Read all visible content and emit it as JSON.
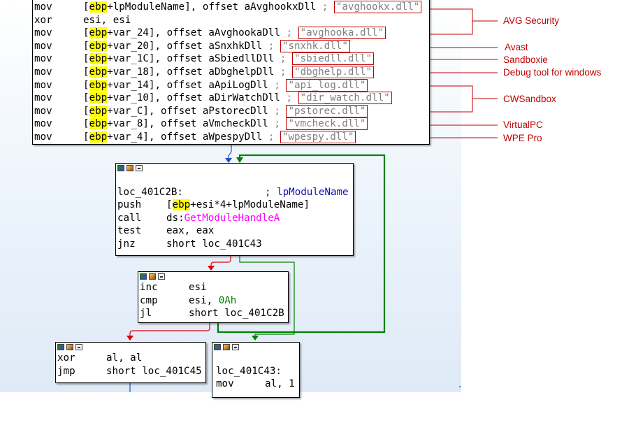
{
  "top_block": {
    "rows": [
      {
        "mn": "mov",
        "hl": "ebp",
        "rest": "+lpModuleName], offset aAvghookxDll",
        "comment": ";",
        "str": "\"avghookx.dll\""
      },
      {
        "mn": "xor",
        "op": "esi, esi"
      },
      {
        "mn": "mov",
        "hl": "ebp",
        "rest": "+var_24], offset aAvghookaDll",
        "comment": ";",
        "str": "\"avghooka.dll\""
      },
      {
        "mn": "mov",
        "hl": "ebp",
        "rest": "+var_20], offset aSnxhkDll",
        "comment": ";",
        "str": "\"snxhk.dll\""
      },
      {
        "mn": "mov",
        "hl": "ebp",
        "rest": "+var_1C], offset aSbiedllDll",
        "comment": ";",
        "str": "\"sbiedll.dll\""
      },
      {
        "mn": "mov",
        "hl": "ebp",
        "rest": "+var_18], offset aDbghelpDll",
        "comment": ";",
        "str": "\"dbghelp.dll\""
      },
      {
        "mn": "mov",
        "hl": "ebp",
        "rest": "+var_14], offset aApiLogDll",
        "comment": ";",
        "str": "\"api_log.dll\""
      },
      {
        "mn": "mov",
        "hl": "ebp",
        "rest": "+var_10], offset aDirWatchDll",
        "comment": ";",
        "str": "\"dir_watch.dll\""
      },
      {
        "mn": "mov",
        "hl": "ebp",
        "rest": "+var_C], offset aPstorecDll",
        "comment": ";",
        "str": "\"pstorec.dll\""
      },
      {
        "mn": "mov",
        "hl": "ebp",
        "rest": "+var_8], offset aVmcheckDll",
        "comment": ";",
        "str": "\"vmcheck.dll\""
      },
      {
        "mn": "mov",
        "hl": "ebp",
        "rest": "+var_4], offset aWpespyDll",
        "comment": ";",
        "str": "\"wpespy.dll\""
      }
    ]
  },
  "annotations": {
    "avg": "AVG Security",
    "avast": "Avast",
    "sandboxie": "Sandboxie",
    "debug": "Debug tool for windows",
    "cwsandbox": "CWSandbox",
    "virtualpc": "VirtualPC",
    "wpe": "WPE Pro"
  },
  "loop_block": {
    "label": "loc_401C2B:",
    "label_comment": "; lpModuleName",
    "r1_mn": "push",
    "r1_a": "[",
    "r1_hl": "ebp",
    "r1_b": "+esi*4+lpModuleName]",
    "r2_mn": "call",
    "r2_a": "ds:",
    "r2_api": "GetModuleHandleA",
    "r3_mn": "test",
    "r3_op": "eax, eax",
    "r4_mn": "jnz",
    "r4_op": "short loc_401C43"
  },
  "inc_block": {
    "r1_mn": "inc",
    "r1_op": "esi",
    "r2_mn": "cmp",
    "r2_a": "esi, ",
    "r2_num": "0Ah",
    "r3_mn": "jl",
    "r3_op": "short loc_401C2B"
  },
  "xor_block": {
    "r1_mn": "xor",
    "r1_op": "al, al",
    "r2_mn": "jmp",
    "r2_op": "short loc_401C45"
  },
  "found_block": {
    "label": "loc_401C43:",
    "r1_mn": "mov",
    "r1_op": "al, 1"
  },
  "colors": {
    "true_edge": "#008000",
    "false_edge": "#e00000",
    "next_edge": "#1e50c8",
    "annotation": "#c00000"
  }
}
